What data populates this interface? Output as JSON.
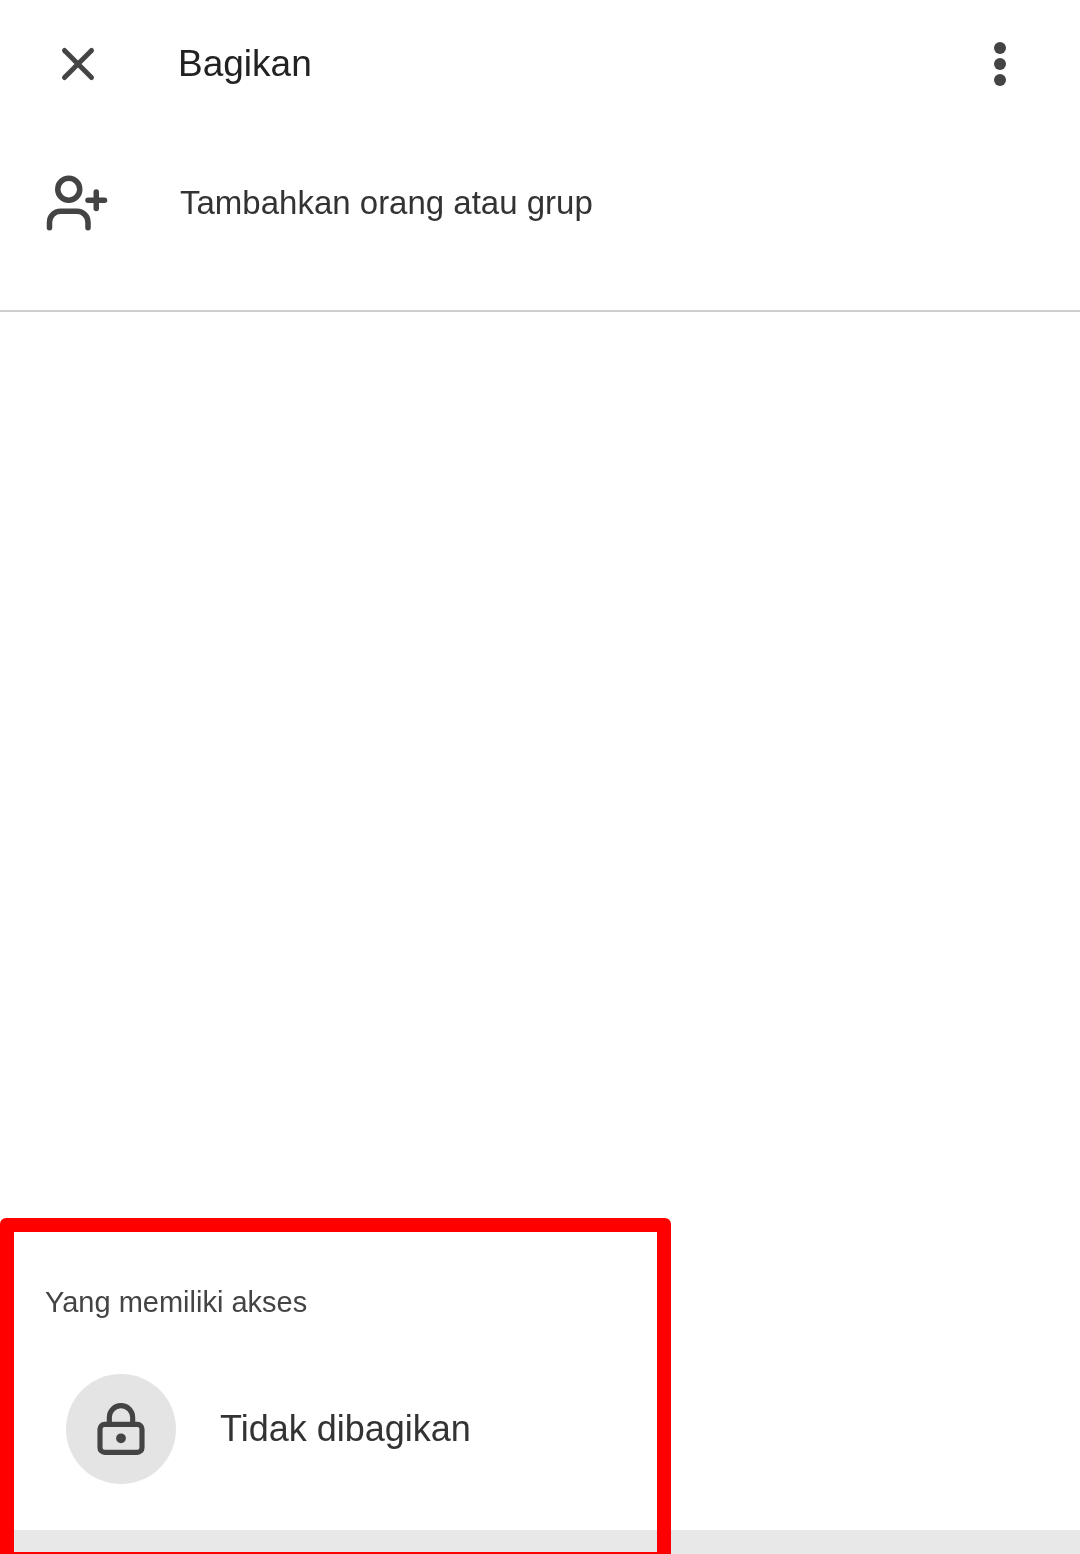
{
  "header": {
    "title": "Bagikan"
  },
  "add_people": {
    "label": "Tambahkan orang atau grup"
  },
  "access": {
    "heading": "Yang memiliki akses",
    "status": "Tidak dibagikan"
  }
}
